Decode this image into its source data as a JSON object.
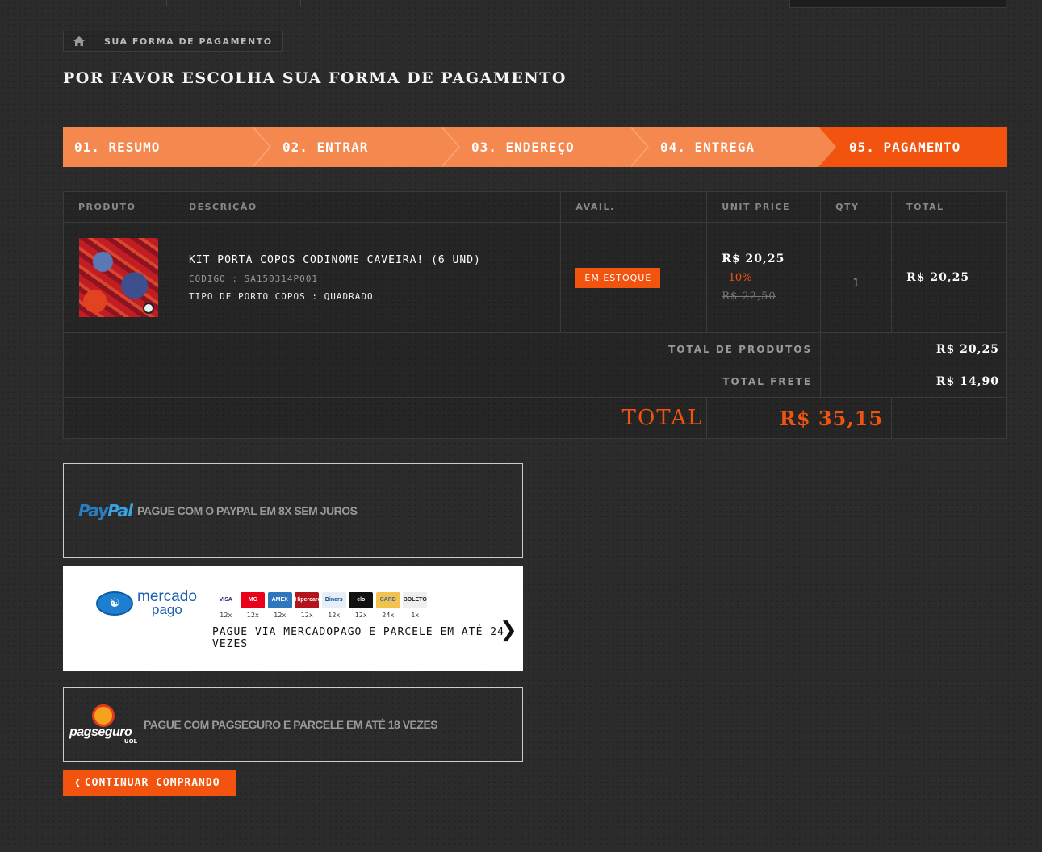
{
  "breadcrumb": {
    "current": "Sua forma de pagamento"
  },
  "page": {
    "title": "Por favor escolha sua forma de pagamento"
  },
  "steps": [
    {
      "label": "01. Resumo",
      "active": false
    },
    {
      "label": "02. Entrar",
      "active": false
    },
    {
      "label": "03. Endereço",
      "active": false
    },
    {
      "label": "04. Entrega",
      "active": false
    },
    {
      "label": "05. Pagamento",
      "active": true
    }
  ],
  "table": {
    "headers": [
      "Produto",
      "Descrição",
      "Avail.",
      "Unit price",
      "Qty",
      "Total"
    ],
    "item": {
      "name": "KIT PORTA COPOS CODINOME CAVEIRA! (6 UND)",
      "code": "CÓDIGO : SA150314P001",
      "attribute": "TIPO DE PORTO COPOS : QUADRADO",
      "availability": "EM ESTOQUE",
      "unit_price": "R$ 20,25",
      "discount": "-10%",
      "old_price": "R$ 22,50",
      "qty": "1",
      "total": "R$ 20,25"
    },
    "summary": {
      "products_label": "TOTAL DE PRODUTOS",
      "products_value": "R$ 20,25",
      "shipping_label": "TOTAL FRETE",
      "shipping_value": "R$ 14,90",
      "total_label": "TOTAL",
      "total_value": "R$ 35,15"
    }
  },
  "payments": {
    "paypal": {
      "logo_text_1": "Pay",
      "logo_text_2": "Pal",
      "text": "Pague com o PayPal em 8x sem juros"
    },
    "mercadopago": {
      "logo_line1": "mercado",
      "logo_line2": "pago",
      "cards": [
        {
          "name": "VISA",
          "installments": "12x",
          "color": "#ffffff",
          "text_color": "#1a1f71"
        },
        {
          "name": "MC",
          "installments": "12x",
          "color": "#eb001b",
          "text_color": "#ffffff"
        },
        {
          "name": "AMEX",
          "installments": "12x",
          "color": "#2e77bc",
          "text_color": "#ffffff"
        },
        {
          "name": "Hipercard",
          "installments": "12x",
          "color": "#b3131b",
          "text_color": "#ffffff"
        },
        {
          "name": "Diners",
          "installments": "12x",
          "color": "#e8eef6",
          "text_color": "#004a97"
        },
        {
          "name": "elo",
          "installments": "12x",
          "color": "#111111",
          "text_color": "#ffffff"
        },
        {
          "name": "CARD",
          "installments": "24x",
          "color": "#f2c14e",
          "text_color": "#3a6ea5"
        },
        {
          "name": "BOLETO",
          "installments": "1x",
          "color": "#eeeeee",
          "text_color": "#222222"
        }
      ],
      "text": "PAGUE VIA MERCADOPAGO E PARCELE EM ATÉ 24 VEZES"
    },
    "pagseguro": {
      "logo_word": "pagseguro",
      "logo_sub": "UOL",
      "text": "Pague com PagSeguro e parcele em até 18 vezes"
    }
  },
  "actions": {
    "continue_label": "Continuar comprando"
  }
}
